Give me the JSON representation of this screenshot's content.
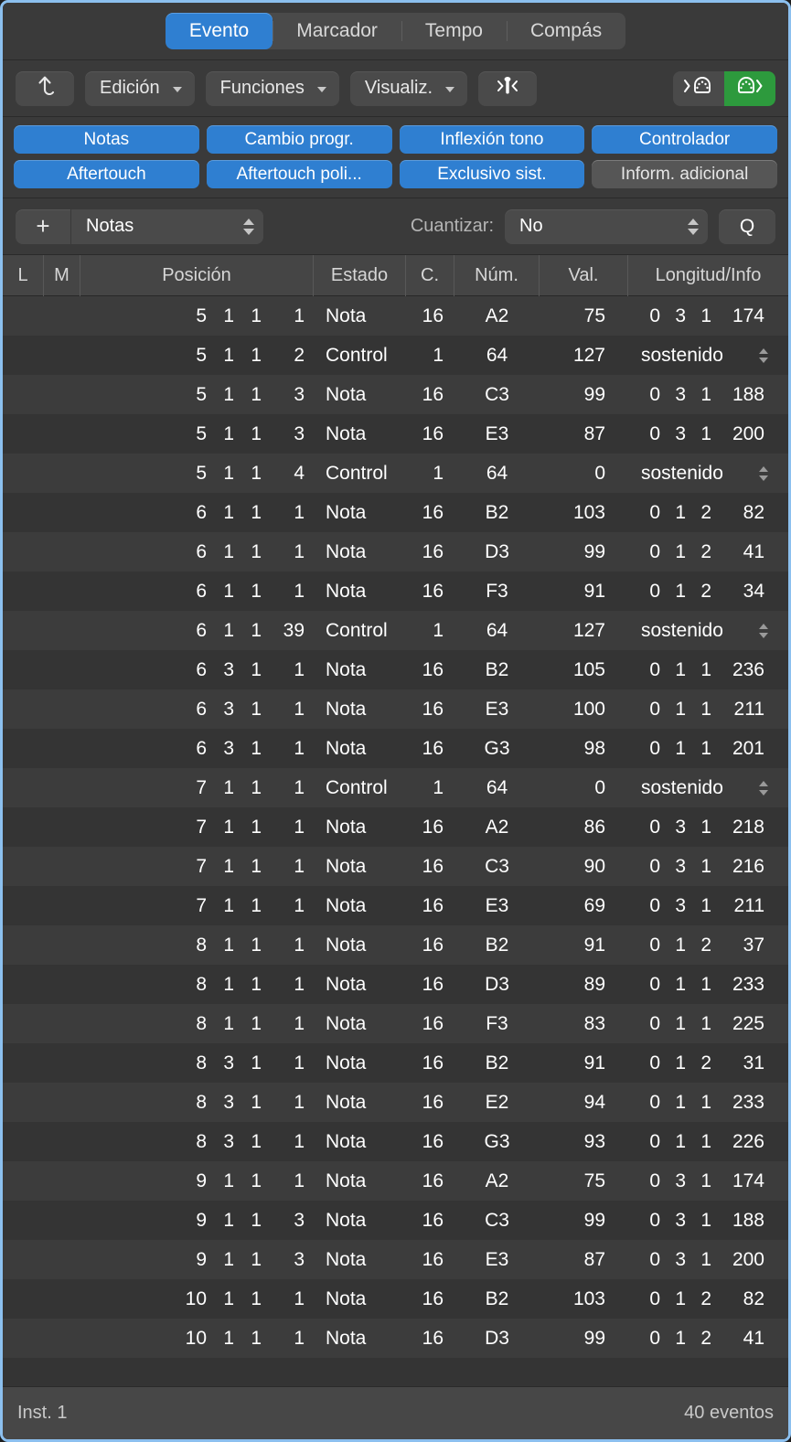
{
  "window": {
    "accent_blue": "#2f7fd1",
    "accent_green": "#2d9a3d",
    "frame_color": "#8cc0ef"
  },
  "tabs": [
    {
      "label": "Evento",
      "active": true
    },
    {
      "label": "Marcador",
      "active": false
    },
    {
      "label": "Tempo",
      "active": false
    },
    {
      "label": "Compás",
      "active": false
    }
  ],
  "toolbar": {
    "hierarchy_icon": "up-arrow-curve-icon",
    "menus": [
      {
        "label": "Edición"
      },
      {
        "label": "Funciones"
      },
      {
        "label": "Visualiz."
      }
    ],
    "midi_thru_icon": "midi-thru-icon",
    "midi_in_icon": "midi-in-icon",
    "midi_out_icon": "midi-out-icon",
    "midi_out_active": true
  },
  "filters": [
    {
      "label": "Notas",
      "active": true
    },
    {
      "label": "Cambio progr.",
      "active": true
    },
    {
      "label": "Inflexión tono",
      "active": true
    },
    {
      "label": "Controlador",
      "active": true
    },
    {
      "label": "Aftertouch",
      "active": true
    },
    {
      "label": "Aftertouch poli...",
      "active": true
    },
    {
      "label": "Exclusivo sist.",
      "active": true
    },
    {
      "label": "Inform. adicional",
      "active": false
    }
  ],
  "controls": {
    "add_label": "+",
    "add_type": "Notas",
    "quantize_label": "Cuantizar:",
    "quantize_value": "No",
    "q_button": "Q"
  },
  "table": {
    "columns": [
      {
        "key": "L",
        "label": "L"
      },
      {
        "key": "M",
        "label": "M"
      },
      {
        "key": "Posición",
        "label": "Posición"
      },
      {
        "key": "Estado",
        "label": "Estado"
      },
      {
        "key": "C.",
        "label": "C."
      },
      {
        "key": "Núm.",
        "label": "Núm."
      },
      {
        "key": "Val.",
        "label": "Val."
      },
      {
        "key": "Longitud/Info",
        "label": "Longitud/Info"
      }
    ],
    "rows": [
      {
        "bar": "5",
        "beat": "1",
        "div": "1",
        "tick": "1",
        "estado": "Nota",
        "canal": "16",
        "num": "A2",
        "val": "75",
        "len": [
          "0",
          "3",
          "1",
          "174"
        ],
        "info": ""
      },
      {
        "bar": "5",
        "beat": "1",
        "div": "1",
        "tick": "2",
        "estado": "Control",
        "canal": "1",
        "num": "64",
        "val": "127",
        "len": null,
        "info": "sostenido"
      },
      {
        "bar": "5",
        "beat": "1",
        "div": "1",
        "tick": "3",
        "estado": "Nota",
        "canal": "16",
        "num": "C3",
        "val": "99",
        "len": [
          "0",
          "3",
          "1",
          "188"
        ],
        "info": ""
      },
      {
        "bar": "5",
        "beat": "1",
        "div": "1",
        "tick": "3",
        "estado": "Nota",
        "canal": "16",
        "num": "E3",
        "val": "87",
        "len": [
          "0",
          "3",
          "1",
          "200"
        ],
        "info": ""
      },
      {
        "bar": "5",
        "beat": "1",
        "div": "1",
        "tick": "4",
        "estado": "Control",
        "canal": "1",
        "num": "64",
        "val": "0",
        "len": null,
        "info": "sostenido"
      },
      {
        "bar": "6",
        "beat": "1",
        "div": "1",
        "tick": "1",
        "estado": "Nota",
        "canal": "16",
        "num": "B2",
        "val": "103",
        "len": [
          "0",
          "1",
          "2",
          "82"
        ],
        "info": ""
      },
      {
        "bar": "6",
        "beat": "1",
        "div": "1",
        "tick": "1",
        "estado": "Nota",
        "canal": "16",
        "num": "D3",
        "val": "99",
        "len": [
          "0",
          "1",
          "2",
          "41"
        ],
        "info": ""
      },
      {
        "bar": "6",
        "beat": "1",
        "div": "1",
        "tick": "1",
        "estado": "Nota",
        "canal": "16",
        "num": "F3",
        "val": "91",
        "len": [
          "0",
          "1",
          "2",
          "34"
        ],
        "info": ""
      },
      {
        "bar": "6",
        "beat": "1",
        "div": "1",
        "tick": "39",
        "estado": "Control",
        "canal": "1",
        "num": "64",
        "val": "127",
        "len": null,
        "info": "sostenido"
      },
      {
        "bar": "6",
        "beat": "3",
        "div": "1",
        "tick": "1",
        "estado": "Nota",
        "canal": "16",
        "num": "B2",
        "val": "105",
        "len": [
          "0",
          "1",
          "1",
          "236"
        ],
        "info": ""
      },
      {
        "bar": "6",
        "beat": "3",
        "div": "1",
        "tick": "1",
        "estado": "Nota",
        "canal": "16",
        "num": "E3",
        "val": "100",
        "len": [
          "0",
          "1",
          "1",
          "211"
        ],
        "info": ""
      },
      {
        "bar": "6",
        "beat": "3",
        "div": "1",
        "tick": "1",
        "estado": "Nota",
        "canal": "16",
        "num": "G3",
        "val": "98",
        "len": [
          "0",
          "1",
          "1",
          "201"
        ],
        "info": ""
      },
      {
        "bar": "7",
        "beat": "1",
        "div": "1",
        "tick": "1",
        "estado": "Control",
        "canal": "1",
        "num": "64",
        "val": "0",
        "len": null,
        "info": "sostenido"
      },
      {
        "bar": "7",
        "beat": "1",
        "div": "1",
        "tick": "1",
        "estado": "Nota",
        "canal": "16",
        "num": "A2",
        "val": "86",
        "len": [
          "0",
          "3",
          "1",
          "218"
        ],
        "info": ""
      },
      {
        "bar": "7",
        "beat": "1",
        "div": "1",
        "tick": "1",
        "estado": "Nota",
        "canal": "16",
        "num": "C3",
        "val": "90",
        "len": [
          "0",
          "3",
          "1",
          "216"
        ],
        "info": ""
      },
      {
        "bar": "7",
        "beat": "1",
        "div": "1",
        "tick": "1",
        "estado": "Nota",
        "canal": "16",
        "num": "E3",
        "val": "69",
        "len": [
          "0",
          "3",
          "1",
          "211"
        ],
        "info": ""
      },
      {
        "bar": "8",
        "beat": "1",
        "div": "1",
        "tick": "1",
        "estado": "Nota",
        "canal": "16",
        "num": "B2",
        "val": "91",
        "len": [
          "0",
          "1",
          "2",
          "37"
        ],
        "info": ""
      },
      {
        "bar": "8",
        "beat": "1",
        "div": "1",
        "tick": "1",
        "estado": "Nota",
        "canal": "16",
        "num": "D3",
        "val": "89",
        "len": [
          "0",
          "1",
          "1",
          "233"
        ],
        "info": ""
      },
      {
        "bar": "8",
        "beat": "1",
        "div": "1",
        "tick": "1",
        "estado": "Nota",
        "canal": "16",
        "num": "F3",
        "val": "83",
        "len": [
          "0",
          "1",
          "1",
          "225"
        ],
        "info": ""
      },
      {
        "bar": "8",
        "beat": "3",
        "div": "1",
        "tick": "1",
        "estado": "Nota",
        "canal": "16",
        "num": "B2",
        "val": "91",
        "len": [
          "0",
          "1",
          "2",
          "31"
        ],
        "info": ""
      },
      {
        "bar": "8",
        "beat": "3",
        "div": "1",
        "tick": "1",
        "estado": "Nota",
        "canal": "16",
        "num": "E2",
        "val": "94",
        "len": [
          "0",
          "1",
          "1",
          "233"
        ],
        "info": ""
      },
      {
        "bar": "8",
        "beat": "3",
        "div": "1",
        "tick": "1",
        "estado": "Nota",
        "canal": "16",
        "num": "G3",
        "val": "93",
        "len": [
          "0",
          "1",
          "1",
          "226"
        ],
        "info": ""
      },
      {
        "bar": "9",
        "beat": "1",
        "div": "1",
        "tick": "1",
        "estado": "Nota",
        "canal": "16",
        "num": "A2",
        "val": "75",
        "len": [
          "0",
          "3",
          "1",
          "174"
        ],
        "info": ""
      },
      {
        "bar": "9",
        "beat": "1",
        "div": "1",
        "tick": "3",
        "estado": "Nota",
        "canal": "16",
        "num": "C3",
        "val": "99",
        "len": [
          "0",
          "3",
          "1",
          "188"
        ],
        "info": ""
      },
      {
        "bar": "9",
        "beat": "1",
        "div": "1",
        "tick": "3",
        "estado": "Nota",
        "canal": "16",
        "num": "E3",
        "val": "87",
        "len": [
          "0",
          "3",
          "1",
          "200"
        ],
        "info": ""
      },
      {
        "bar": "10",
        "beat": "1",
        "div": "1",
        "tick": "1",
        "estado": "Nota",
        "canal": "16",
        "num": "B2",
        "val": "103",
        "len": [
          "0",
          "1",
          "2",
          "82"
        ],
        "info": ""
      },
      {
        "bar": "10",
        "beat": "1",
        "div": "1",
        "tick": "1",
        "estado": "Nota",
        "canal": "16",
        "num": "D3",
        "val": "99",
        "len": [
          "0",
          "1",
          "2",
          "41"
        ],
        "info": ""
      }
    ]
  },
  "statusbar": {
    "instrument": "Inst. 1",
    "event_count": "40 eventos"
  }
}
